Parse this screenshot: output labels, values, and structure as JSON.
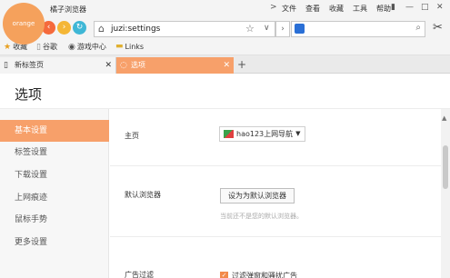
{
  "app": {
    "logo_text": "orange",
    "title": "橘子浏览器",
    "menu": [
      "文件",
      "查看",
      "收藏",
      "工具",
      "帮助"
    ],
    "menu_chevron": ">"
  },
  "nav": {
    "back_icon": "back-arrow-icon",
    "forward_icon": "forward-arrow-icon",
    "refresh_icon": "refresh-icon",
    "address_value": "juzi:settings",
    "search_value": ""
  },
  "bookmarks": [
    {
      "label": "收藏",
      "icon": "star-icon"
    },
    {
      "label": "谷歌",
      "icon": "page-icon"
    },
    {
      "label": "游戏中心",
      "icon": "gamepad-icon"
    },
    {
      "label": "Links",
      "icon": "folder-icon"
    }
  ],
  "tabs": [
    {
      "label": "新标签页",
      "active": false
    },
    {
      "label": "选项",
      "active": true
    }
  ],
  "page": {
    "title": "选项",
    "sidebar": [
      "基本设置",
      "标签设置",
      "下载设置",
      "上网痕迹",
      "鼠标手势",
      "更多设置"
    ],
    "homepage_label": "主页",
    "homepage_value": "hao123上网导航",
    "default_browser_label": "默认浏览器",
    "default_browser_button": "设为为默认浏览器",
    "default_browser_hint": "当前还不是您的默认浏览器。",
    "adblock_label": "广告过滤",
    "adblock_option": "过滤弹窗和骚扰广告",
    "adblock_checked": true
  },
  "colors": {
    "accent": "#f7a06a",
    "logo": "#f5a15c"
  }
}
